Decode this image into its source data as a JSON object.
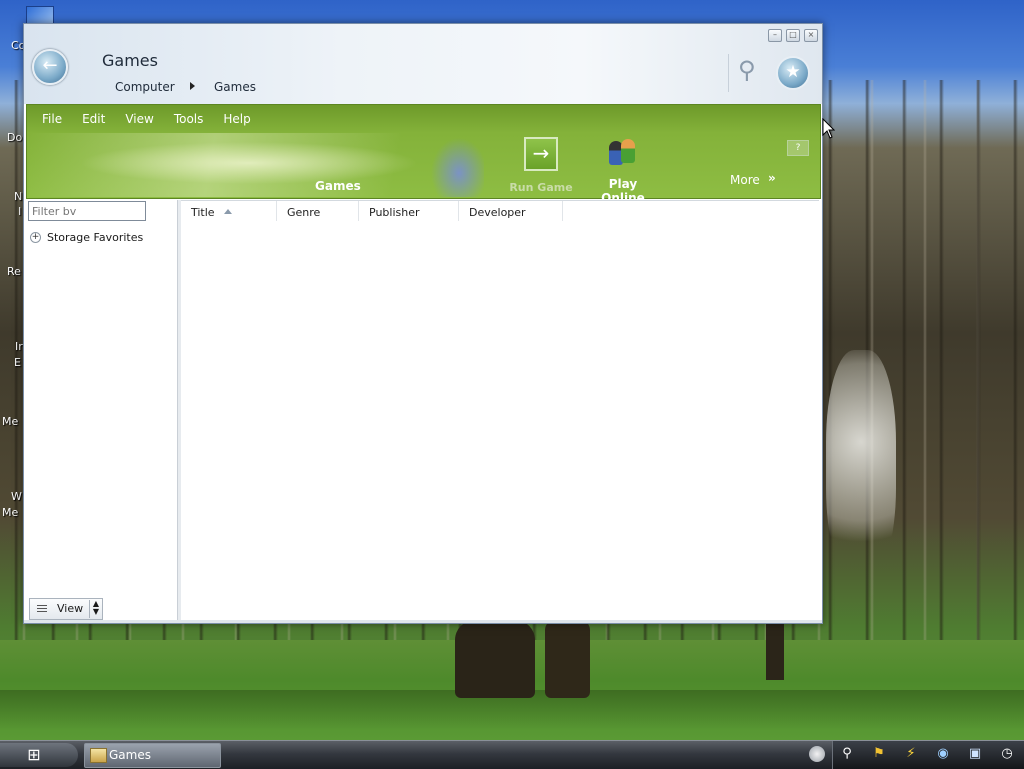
{
  "desktop": {
    "icon_labels": [
      "Co",
      "Do",
      "N",
      "I",
      "Re",
      "Ir",
      "E",
      "Me",
      "W",
      "Me"
    ]
  },
  "window": {
    "title": "Games",
    "breadcrumb": [
      "Computer",
      "Games"
    ],
    "controls": {
      "minimize": "–",
      "maximize": "□",
      "close": "×"
    }
  },
  "menu": {
    "items": [
      "File",
      "Edit",
      "View",
      "Tools",
      "Help"
    ]
  },
  "toolbar": {
    "section_label": "Games",
    "run_game_label": "Run Game",
    "play_online_label": "Play Online",
    "more_label": "More",
    "more_arrow": "»",
    "run_icon": "→"
  },
  "left_pane": {
    "filter_placeholder": "Filter bv",
    "tree_items": [
      "Storage Favorites"
    ],
    "view_label": "View"
  },
  "columns": [
    "Title",
    "Genre",
    "Publisher",
    "Developer"
  ],
  "taskbar": {
    "task_label": "Games",
    "start_glyph": "⊞"
  },
  "icons": {
    "back": "back-arrow-icon",
    "search": "magnifier-icon",
    "favorite": "star-icon",
    "tray": [
      "magnifier-icon",
      "bell-icon",
      "lightning-icon",
      "network-icon",
      "monitor-icon",
      "clock-icon"
    ]
  },
  "colors": {
    "toolbar_green": "#84b23a",
    "taskbar_dark": "#34383f",
    "titlebar_light": "#eef3f8"
  }
}
